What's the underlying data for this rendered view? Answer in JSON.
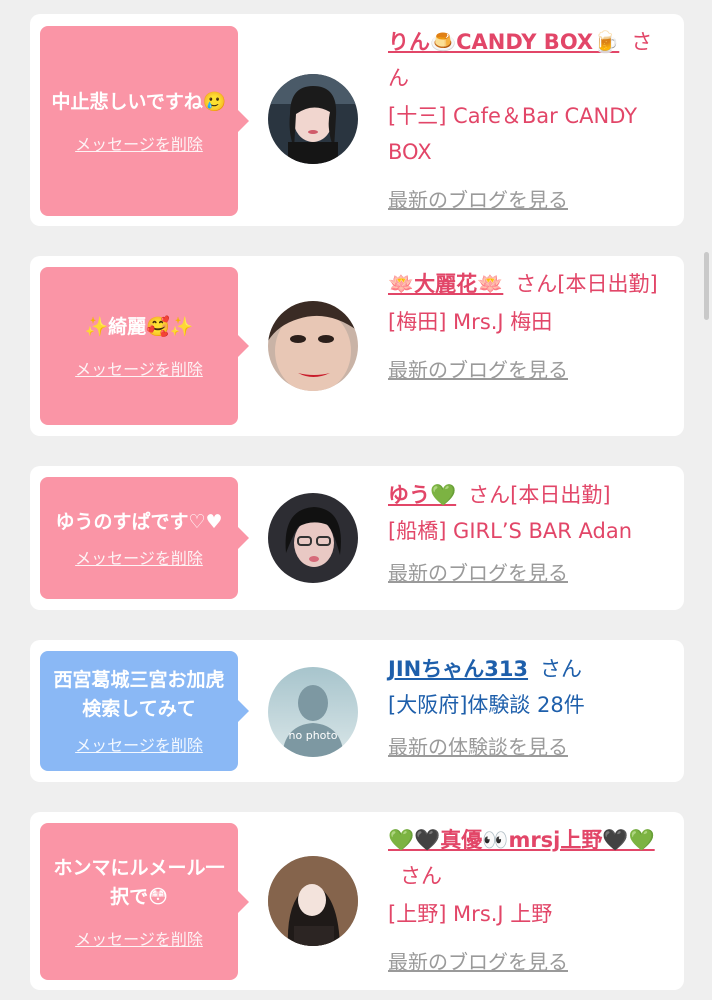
{
  "messages": [
    {
      "bubble_text": "中止悲しいですね🥲",
      "delete_label": "メッセージを削除",
      "name": "りん🍮CANDY BOX🍺",
      "honorific": "さん",
      "shop": "[十三] Cafe＆Bar CANDY BOX",
      "link": "最新のブログを見る"
    },
    {
      "bubble_text": "✨綺麗🥰✨",
      "delete_label": "メッセージを削除",
      "name": "🪷大麗花🪷",
      "honorific": "さん[本日出勤]",
      "shop": "[梅田] Mrs.J 梅田",
      "link": "最新のブログを見る"
    },
    {
      "bubble_text": "ゆうのすぱです♡♥",
      "delete_label": "メッセージを削除",
      "name": "ゆう💚",
      "honorific": "さん[本日出勤]",
      "shop": "[船橋] GIRL’S BAR Adan",
      "link": "最新のブログを見る"
    },
    {
      "bubble_text": "西宮葛城三宮お加虎検索してみて",
      "delete_label": "メッセージを削除",
      "name": "JINちゃん313",
      "honorific": "さん",
      "shop": "[大阪府]体験談 28件",
      "link": "最新の体験談を見る",
      "avatar_text": "no photo"
    },
    {
      "bubble_text": "ホンマにルメール一択で😳",
      "delete_label": "メッセージを削除",
      "name": "💚🖤真優👀mrsj上野🖤💚",
      "honorific": "さん",
      "shop": "[上野] Mrs.J 上野",
      "link": "最新のブログを見る"
    }
  ],
  "colors": {
    "pink_text": "#e24668",
    "blue_text": "#1e5fab",
    "pink_bubble": "#fa95a6",
    "blue_bubble": "#8ab8f5",
    "link_gray": "#9a9a9a"
  }
}
